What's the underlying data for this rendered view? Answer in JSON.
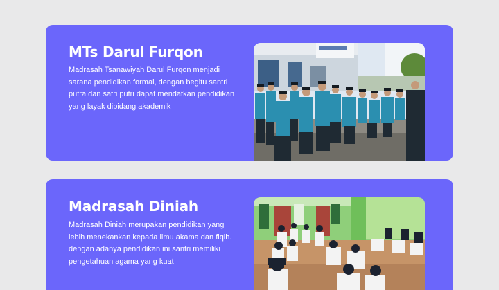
{
  "cards": [
    {
      "title": "MTs Darul Furqon",
      "description": "Madrasah Tsanawiyah Darul Furqon menjadi sarana pendidikan formal, dengan begitu santri putra dan satri putri dapat mendatkan pendidikan yang layak dibidang akademik"
    },
    {
      "title": "Madrasah Diniah",
      "description": "Madrasah Diniah merupakan pendidikan yang lebih menekankan kepada ilmu akama dan fiqih. dengan adanya pendidikan ini santri memiliki pengetahuan agama yang kuat"
    }
  ],
  "colors": {
    "page_background": "#e9e9ea",
    "card_background": "#6b66fb",
    "text": "#ffffff"
  }
}
